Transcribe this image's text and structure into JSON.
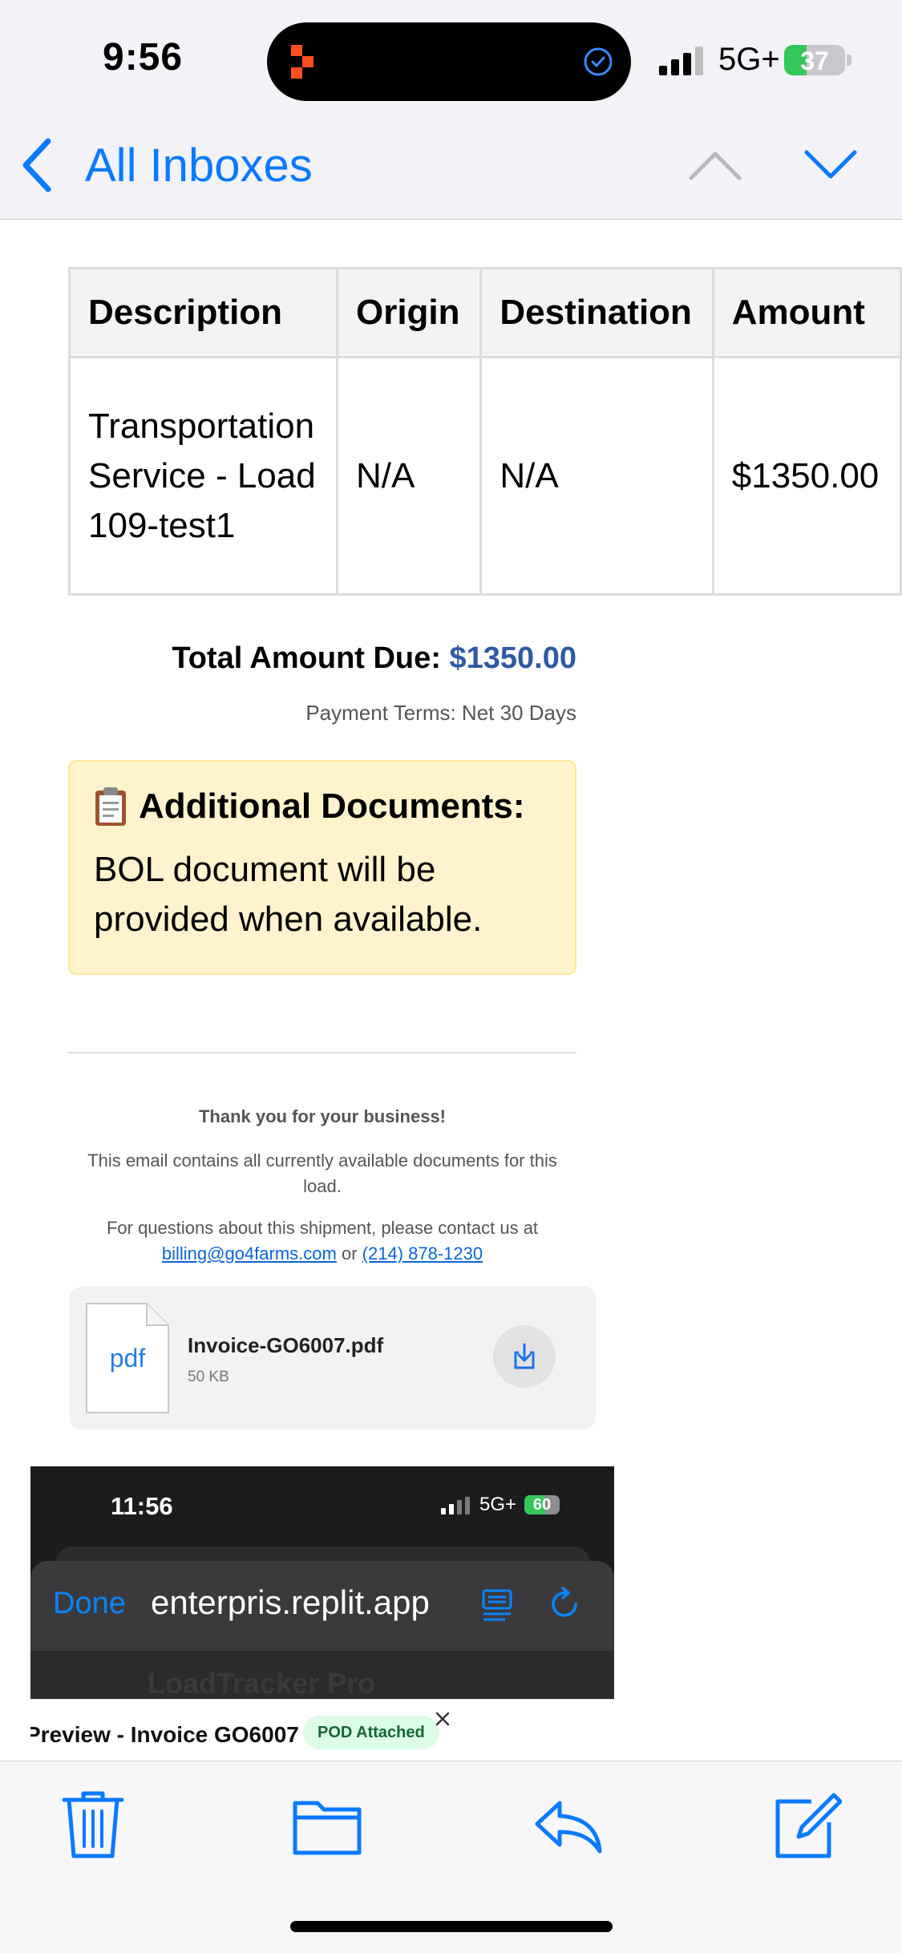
{
  "status_bar": {
    "time": "9:56",
    "network": "5G+",
    "battery_level": "37",
    "battery_fraction": 0.37
  },
  "nav": {
    "back_label": "All Inboxes"
  },
  "invoice_table": {
    "headers": [
      "Description",
      "Origin",
      "Destination",
      "Amount"
    ],
    "rows": [
      {
        "description": "Transportation Service - Load 109-test1",
        "origin": "N/A",
        "destination": "N/A",
        "amount": "$1350.00"
      }
    ]
  },
  "totals": {
    "label": "Total Amount Due:",
    "amount": "$1350.00",
    "payment_terms": "Payment Terms: Net 30 Days"
  },
  "additional_documents": {
    "heading": "Additional Documents:",
    "text": "BOL document will be provided when available."
  },
  "footer": {
    "thank_you": "Thank you for your business!",
    "note": "This email contains all currently available documents for this load.",
    "contact_prefix": "For questions about this shipment, please contact us at",
    "email": "billing@go4farms.com",
    "or_text": "or",
    "phone": "(214) 878-1230"
  },
  "attachment": {
    "thumb_label": "pdf",
    "name": "Invoice-GO6007.pdf",
    "size": "50 KB"
  },
  "embedded_screenshot": {
    "time": "11:56",
    "network": "5G+",
    "battery_level": "60",
    "battery_fraction": 0.6,
    "done_label": "Done",
    "url": "enterpris.replit.app",
    "app_title": "LoadTracker Pro",
    "preview_title": "Preview - Invoice GO6007",
    "badge": "POD Attached"
  },
  "colors": {
    "ios_blue": "#0a7aff",
    "total_amount": "#2e5aa3",
    "notice_bg": "#fff3cd",
    "badge_bg": "#dcfce7",
    "badge_text": "#166534",
    "battery_green": "#34c759"
  },
  "icons": {
    "back": "chevron-left-icon",
    "up": "chevron-up-icon",
    "down": "chevron-down-icon",
    "clipboard": "clipboard-icon",
    "download": "download-icon",
    "trash": "trash-icon",
    "folder": "folder-icon",
    "reply": "reply-icon",
    "compose": "compose-icon"
  }
}
